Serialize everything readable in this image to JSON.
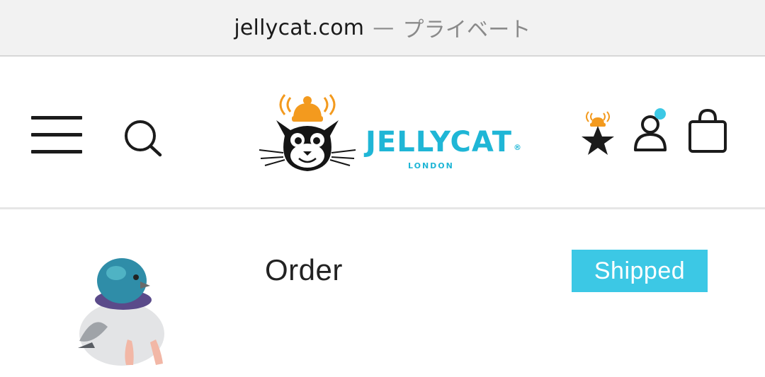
{
  "browser": {
    "domain": "jellycat.com",
    "separator": "—",
    "mode": "プライベート"
  },
  "header": {
    "logo": {
      "wordmark": "JELLYCAT",
      "registered": "®",
      "subtitle": "LONDON"
    },
    "icons": {
      "menu": "hamburger-menu-icon",
      "search": "search-icon",
      "wishlist": "star-bell-icon",
      "account": "account-icon",
      "bag": "shopping-bag-icon"
    }
  },
  "order": {
    "title": "Order",
    "status": "Shipped"
  },
  "colors": {
    "brand_cyan": "#1fb6d6",
    "badge_bg": "#3cc8e5",
    "accent_orange": "#f39a1e",
    "dark": "#1b1b1b"
  }
}
